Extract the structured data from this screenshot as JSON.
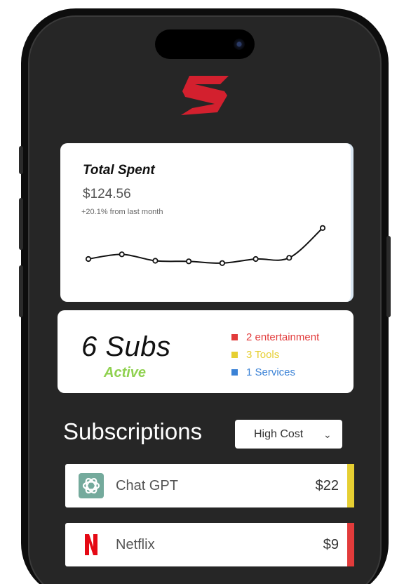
{
  "brand": {
    "logo": "lightning-s-logo",
    "accent": "#d3202e"
  },
  "spending": {
    "title": "Total Spent",
    "amount": "$124.56",
    "change": "+20.1% from last month"
  },
  "chart_data": {
    "type": "line",
    "title": "",
    "xlabel": "",
    "ylabel": "",
    "points": [
      42,
      50,
      39,
      38,
      35,
      42,
      44,
      95
    ],
    "ylim": [
      0,
      120
    ],
    "grid": false,
    "line_color": "#111111"
  },
  "summary": {
    "count": "6 Subs",
    "status": "Active",
    "categories": [
      {
        "label": "2 entertainment",
        "color": "#e23b3b"
      },
      {
        "label": "3 Tools",
        "color": "#e6cf32"
      },
      {
        "label": "1  Services",
        "color": "#3b82d6"
      }
    ]
  },
  "subscriptions": {
    "title": "Subscriptions",
    "sort": {
      "selected": "High Cost",
      "icon": "chevron-down-icon"
    },
    "items": [
      {
        "name": "Chat GPT",
        "price": "$22",
        "icon": "chatgpt-icon",
        "color": "#e6cf32"
      },
      {
        "name": "Netflix",
        "price": "$9",
        "icon": "netflix-icon",
        "color": "#e23b3b"
      }
    ]
  }
}
